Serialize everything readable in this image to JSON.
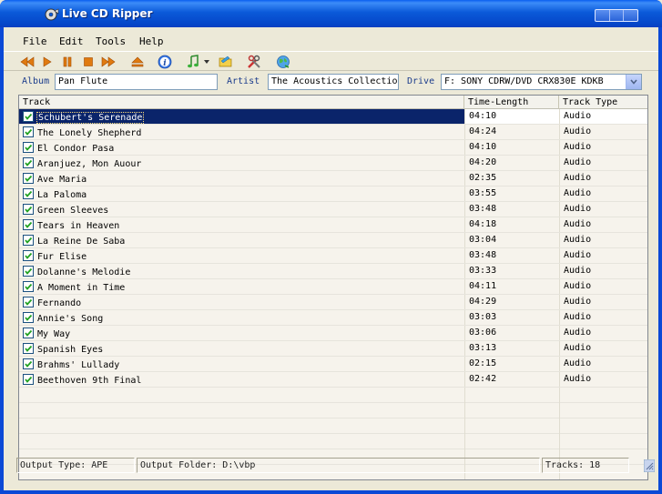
{
  "window": {
    "title": "Live CD Ripper"
  },
  "menu": {
    "file": "File",
    "edit": "Edit",
    "tools": "Tools",
    "help": "Help"
  },
  "toolbar": {
    "icons": [
      "rewind-icon",
      "play-icon",
      "pause-icon",
      "stop-icon",
      "fast-forward-icon",
      "eject-icon",
      "info-icon",
      "music-note-icon",
      "folder-icon",
      "tools-icon",
      "globe-icon"
    ]
  },
  "fields": {
    "album_label": "Album",
    "album_value": "Pan Flute",
    "artist_label": "Artist",
    "artist_value": "The Acoustics Collectio",
    "drive_label": "Drive",
    "drive_value": "F: SONY     CDRW/DVD CRX830E KDKB"
  },
  "list": {
    "columns": [
      "Track",
      "Time-Length",
      "Track Type"
    ],
    "rows": [
      {
        "track": "Schubert's Serenade",
        "time": "04:10",
        "type": "Audio",
        "checked": true,
        "selected": true
      },
      {
        "track": "The Lonely Shepherd",
        "time": "04:24",
        "type": "Audio",
        "checked": true
      },
      {
        "track": "El Condor Pasa",
        "time": "04:10",
        "type": "Audio",
        "checked": true
      },
      {
        "track": "Aranjuez, Mon Auour",
        "time": "04:20",
        "type": "Audio",
        "checked": true
      },
      {
        "track": "Ave Maria",
        "time": "02:35",
        "type": "Audio",
        "checked": true
      },
      {
        "track": "La Paloma",
        "time": "03:55",
        "type": "Audio",
        "checked": true
      },
      {
        "track": "Green Sleeves",
        "time": "03:48",
        "type": "Audio",
        "checked": true
      },
      {
        "track": "Tears in Heaven",
        "time": "04:18",
        "type": "Audio",
        "checked": true
      },
      {
        "track": "La Reine De Saba",
        "time": "03:04",
        "type": "Audio",
        "checked": true
      },
      {
        "track": "Fur Elise",
        "time": "03:48",
        "type": "Audio",
        "checked": true
      },
      {
        "track": "Dolanne's Melodie",
        "time": "03:33",
        "type": "Audio",
        "checked": true
      },
      {
        "track": "A Moment in Time",
        "time": "04:11",
        "type": "Audio",
        "checked": true
      },
      {
        "track": "Fernando",
        "time": "04:29",
        "type": "Audio",
        "checked": true
      },
      {
        "track": "Annie's Song",
        "time": "03:03",
        "type": "Audio",
        "checked": true
      },
      {
        "track": "My Way",
        "time": "03:06",
        "type": "Audio",
        "checked": true
      },
      {
        "track": "Spanish Eyes",
        "time": "03:13",
        "type": "Audio",
        "checked": true
      },
      {
        "track": "Brahms' Lullady",
        "time": "02:15",
        "type": "Audio",
        "checked": true
      },
      {
        "track": "Beethoven 9th Final",
        "time": "02:42",
        "type": "Audio",
        "checked": true
      }
    ]
  },
  "status": {
    "output_type": "Output Type: APE",
    "output_folder": "Output Folder: D:\\vbp",
    "tracks": "Tracks: 18"
  },
  "colors": {
    "selection": "#0a246a",
    "titlebar": "#0b5ad9"
  }
}
